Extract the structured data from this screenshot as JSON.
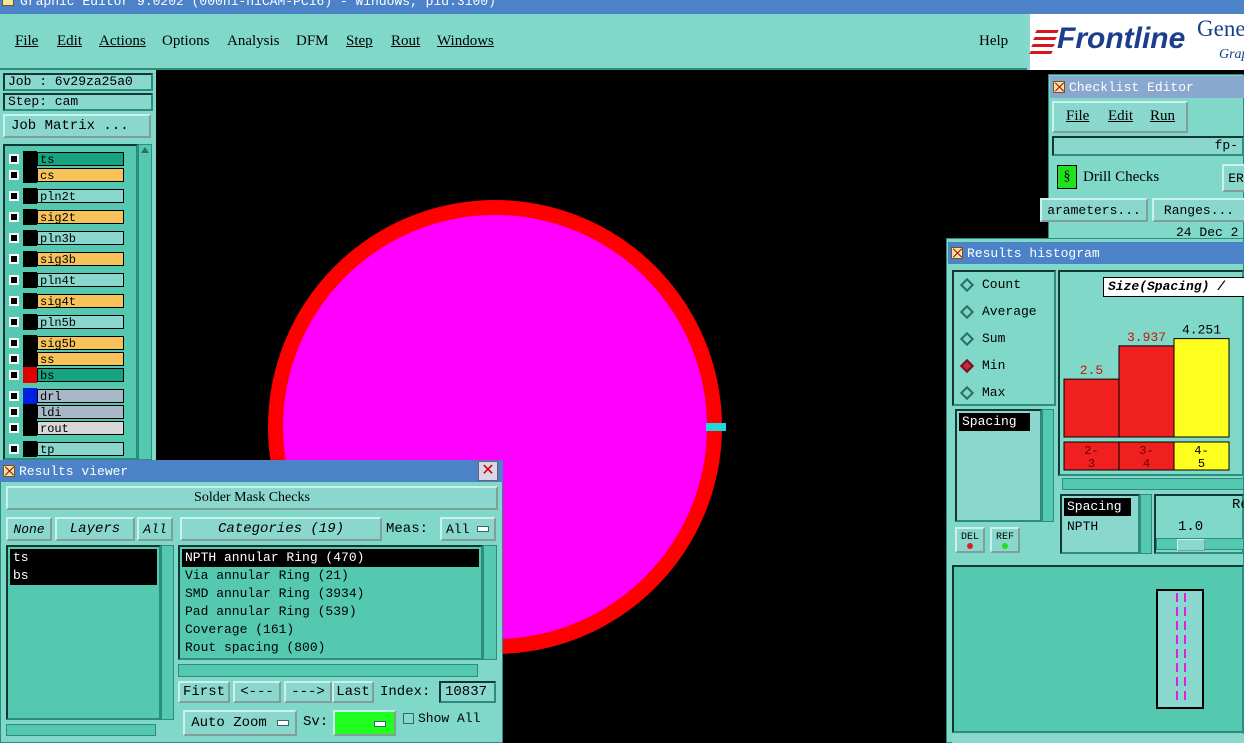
{
  "window_title": "Graphic Editor 9.0202 (000h1-hiCAM-PC16) - Windows, pid:3100)",
  "menu": [
    "File",
    "Edit",
    "Actions",
    "Options",
    "Analysis",
    "DFM",
    "Step",
    "Rout",
    "Windows"
  ],
  "help": "Help",
  "brand": {
    "logo": "Frontline",
    "gen": "Gene",
    "graph": "Grap"
  },
  "job": {
    "job": "Job : 6v29za25a0",
    "step": "Step: cam",
    "matrix": "Job Matrix ..."
  },
  "layers": [
    {
      "name": "ts",
      "color": "#16a37f",
      "swatch": "#000"
    },
    {
      "name": "cs",
      "color": "#f8c25a",
      "swatch": "#000"
    },
    {
      "name": "pln2t",
      "color": "#8ad7cd",
      "swatch": "#000"
    },
    {
      "name": "sig2t",
      "color": "#f8c25a",
      "swatch": "#000"
    },
    {
      "name": "pln3b",
      "color": "#8ad7cd",
      "swatch": "#000"
    },
    {
      "name": "sig3b",
      "color": "#f8c25a",
      "swatch": "#000"
    },
    {
      "name": "pln4t",
      "color": "#8ad7cd",
      "swatch": "#000"
    },
    {
      "name": "sig4t",
      "color": "#f8c25a",
      "swatch": "#000"
    },
    {
      "name": "pln5b",
      "color": "#8ad7cd",
      "swatch": "#000"
    },
    {
      "name": "sig5b",
      "color": "#f8c25a",
      "swatch": "#000"
    },
    {
      "name": "ss",
      "color": "#f8c25a",
      "swatch": "#000"
    },
    {
      "name": "bs",
      "color": "#16a37f",
      "swatch": "#e00000"
    },
    {
      "name": "drl",
      "color": "#a8b8c8",
      "swatch": "#0020e0"
    },
    {
      "name": "ldi",
      "color": "#a8b8c8",
      "swatch": "#000"
    },
    {
      "name": "rout",
      "color": "#d8d8d8",
      "swatch": "#000"
    },
    {
      "name": "tp",
      "color": "#8ad7cd",
      "swatch": "#000"
    }
  ],
  "results_viewer": {
    "title": "Results viewer",
    "header": "Solder Mask Checks",
    "none": "None",
    "layers": "Layers",
    "all": "All",
    "categories": "Categories (19)",
    "meas_label": "Meas:",
    "meas_value": "All",
    "layer_list": [
      "ts",
      "bs"
    ],
    "items": [
      "NPTH annular Ring (470)",
      "Via annular Ring (21)",
      "SMD annular Ring (3934)",
      "Pad annular Ring (539)",
      "Coverage (161)",
      "Rout spacing (800)"
    ],
    "first": "First",
    "prev": "<---",
    "next": "--->",
    "last": "Last",
    "index_label": "Index:",
    "index_value": "10837",
    "auto_zoom": "Auto Zoom",
    "sv": "Sv:",
    "show_all": "Show All"
  },
  "checklist": {
    "title": "Checklist Editor",
    "menu": [
      "File",
      "Edit",
      "Run"
    ],
    "fp": "fp-",
    "drill": "Drill Checks",
    "er": "ER",
    "params": "arameters...",
    "ranges": "Ranges...",
    "date": "24 Dec 2"
  },
  "histogram": {
    "title": "Results histogram",
    "options": [
      "Count",
      "Average",
      "Sum",
      "Min",
      "Max"
    ],
    "selected": "Min",
    "chart_title": "Size(Spacing) /",
    "list_item": "Spacing",
    "del": "DEL",
    "ref": "REF",
    "spacing_label": "Spacing",
    "npth": "NPTH",
    "re": "Re",
    "slider_value": "1.0"
  },
  "chart_data": {
    "type": "bar",
    "title": "Size(Spacing) /",
    "categories": [
      "2-3",
      "3-4",
      "4-5"
    ],
    "values": [
      2.5,
      3.937,
      4.251
    ],
    "value_labels": [
      "2.5",
      "3.937",
      "4.251"
    ],
    "category_lines": [
      [
        "2-",
        "3"
      ],
      [
        "3-",
        "4"
      ],
      [
        "4-",
        "5"
      ]
    ],
    "colors": [
      "#f02020",
      "#f02020",
      "#ffff20"
    ],
    "ylim": [
      0,
      5
    ]
  }
}
